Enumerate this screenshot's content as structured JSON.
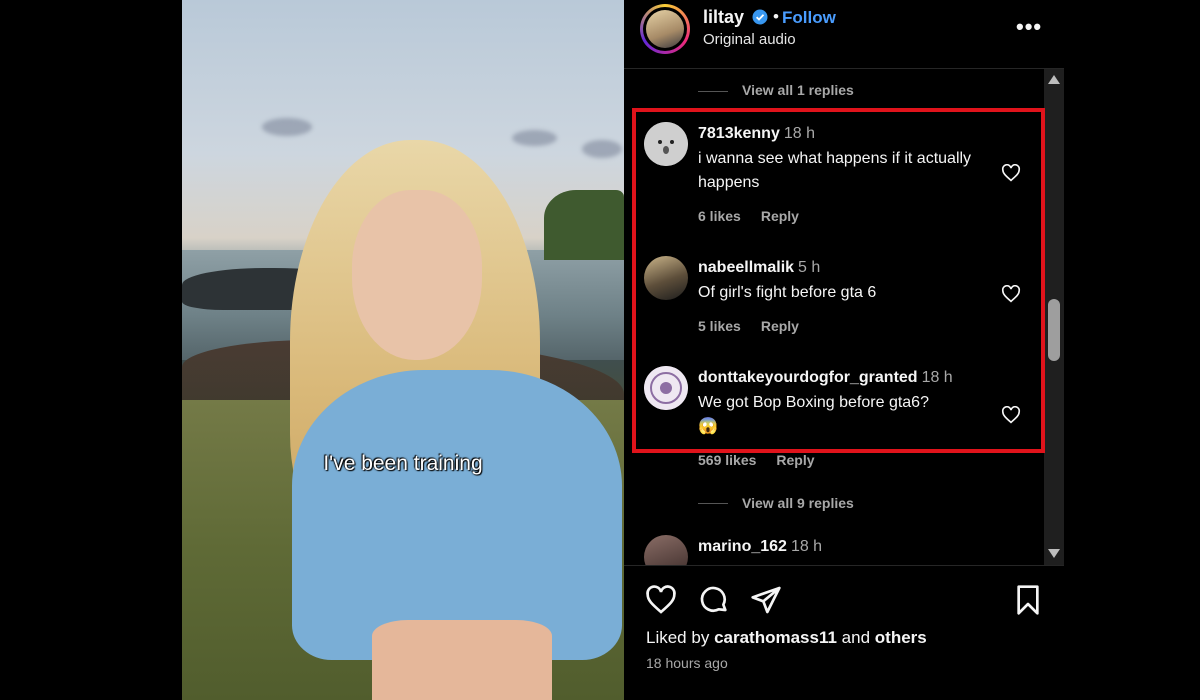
{
  "video": {
    "caption": "I've been training"
  },
  "header": {
    "username": "liltay",
    "separator": "•",
    "follow_label": "Follow",
    "audio_label": "Original audio",
    "more_label": "•••"
  },
  "comments": {
    "top_replies": "View all 1 replies",
    "items": [
      {
        "user": "7813kenny",
        "time": "18 h",
        "text": "i wanna see what happens if it actually happens",
        "likes": "6 likes",
        "reply": "Reply"
      },
      {
        "user": "nabeellmalik",
        "time": "5 h",
        "text": "Of girl's fight before gta 6",
        "likes": "5 likes",
        "reply": "Reply"
      },
      {
        "user": "donttakeyourdogfor_granted",
        "time": "18 h",
        "text": "We got Bop Boxing before gta6?",
        "emoji": "😱",
        "likes": "569 likes",
        "reply": "Reply"
      },
      {
        "user": "marino_162",
        "time": "18 h"
      }
    ],
    "more_replies": "View all 9 replies"
  },
  "footer": {
    "liked_by_prefix": "Liked by",
    "liked_by_user": "carathomass11",
    "liked_by_and": "and",
    "liked_by_others": "others",
    "time_ago": "18 hours ago"
  },
  "colors": {
    "accent": "#4a9dff",
    "highlight": "#e0131b",
    "background": "#000000"
  },
  "icons": [
    "verified-badge-icon",
    "more-options-icon",
    "heart-icon",
    "comment-icon",
    "share-icon",
    "bookmark-icon",
    "scroll-up-icon",
    "scroll-down-icon"
  ]
}
